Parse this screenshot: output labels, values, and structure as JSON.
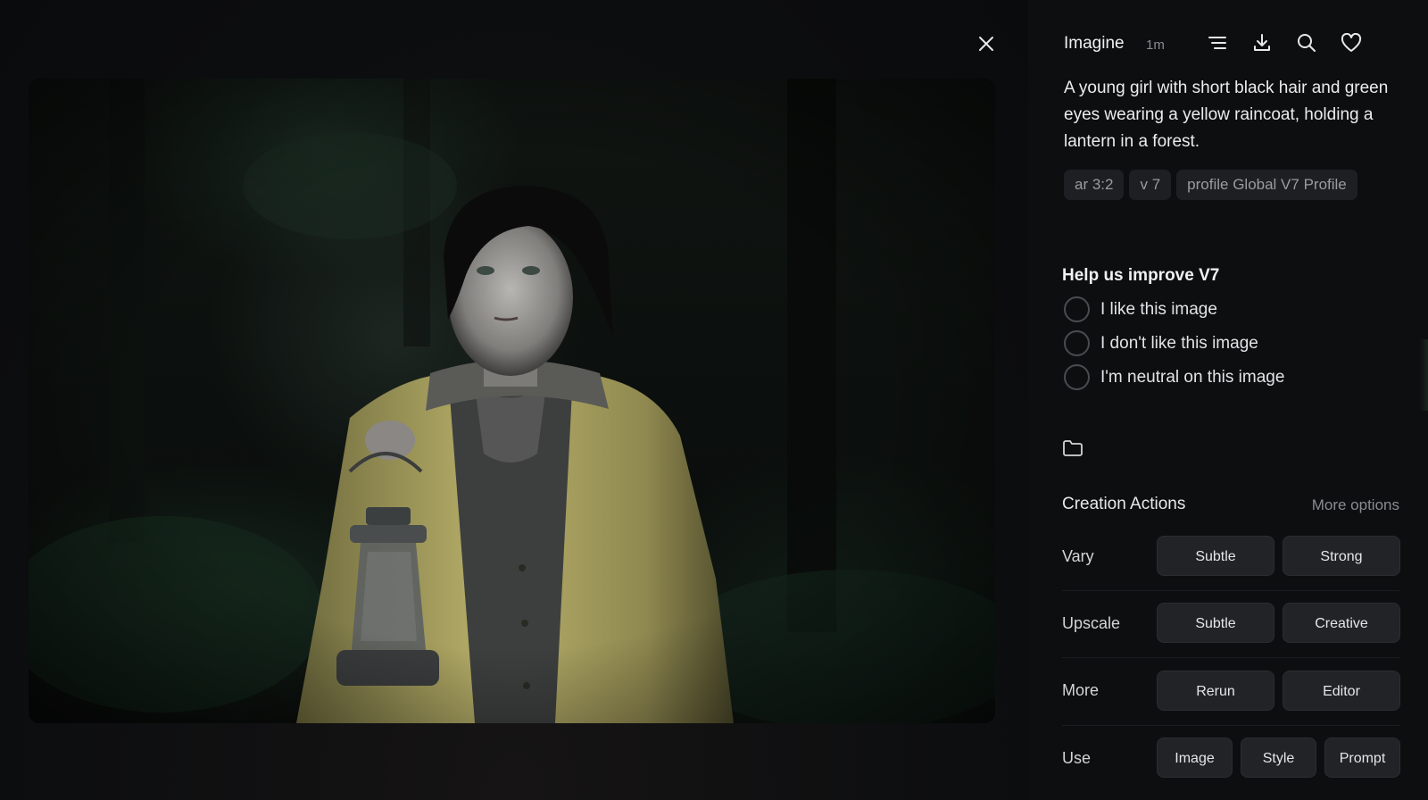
{
  "viewer": {
    "image_alt": "A young girl with short black hair and green eyes wearing a yellow raincoat, holding a lantern in a forest."
  },
  "header": {
    "title": "Imagine",
    "time": "1m",
    "icons": [
      "filter-lines-icon",
      "download-icon",
      "search-icon",
      "heart-icon"
    ]
  },
  "prompt": {
    "text": "A young girl with short black hair and green eyes wearing a yellow raincoat, holding a lantern in a forest.",
    "tags": [
      "ar 3:2",
      "v 7",
      "profile Global V7 Profile"
    ]
  },
  "feedback": {
    "title": "Help us improve V7",
    "options": [
      "I like this image",
      "I don't like this image",
      "I'm neutral on this image"
    ]
  },
  "creation_actions": {
    "title": "Creation Actions",
    "more_options": "More options",
    "rows": [
      {
        "label": "Vary",
        "buttons": [
          "Subtle",
          "Strong"
        ]
      },
      {
        "label": "Upscale",
        "buttons": [
          "Subtle",
          "Creative"
        ]
      },
      {
        "label": "More",
        "buttons": [
          "Rerun",
          "Editor"
        ]
      },
      {
        "label": "Use",
        "buttons": [
          "Image",
          "Style",
          "Prompt"
        ]
      }
    ]
  },
  "colors": {
    "background": "#0b0c0e",
    "panel": "#0d0e10",
    "button": "#222327",
    "tag": "#1e1f23",
    "raincoat": "#b9b16a"
  }
}
